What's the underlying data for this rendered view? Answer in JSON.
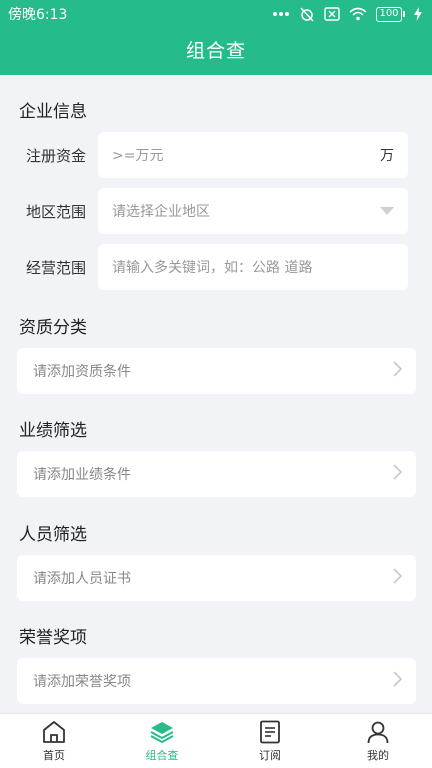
{
  "status_bar": {
    "time": "傍晚6:13",
    "battery": "100"
  },
  "header": {
    "title": "组合查"
  },
  "company_info": {
    "title": "企业信息",
    "capital": {
      "label": "注册资金",
      "placeholder": ">=万元",
      "unit": "万"
    },
    "region": {
      "label": "地区范围",
      "placeholder": "请选择企业地区"
    },
    "business_scope": {
      "label": "经营范围",
      "placeholder": "请输入多关键词，如：公路 道路"
    }
  },
  "qualification": {
    "title": "资质分类",
    "placeholder": "请添加资质条件"
  },
  "performance": {
    "title": "业绩筛选",
    "placeholder": "请添加业绩条件"
  },
  "personnel": {
    "title": "人员筛选",
    "placeholder": "请添加人员证书"
  },
  "honors": {
    "title": "荣誉奖项",
    "placeholder": "请添加荣誉奖项"
  },
  "bottom_nav": {
    "items": [
      {
        "label": "首页",
        "icon": "home-icon"
      },
      {
        "label": "组合查",
        "icon": "layers-icon",
        "active": true
      },
      {
        "label": "订阅",
        "icon": "document-icon"
      },
      {
        "label": "我的",
        "icon": "user-icon"
      }
    ]
  },
  "colors": {
    "accent": "#26bb8a",
    "background": "#f2f3f7"
  }
}
